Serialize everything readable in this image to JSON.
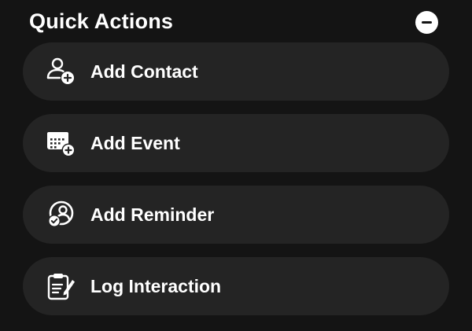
{
  "header": {
    "title": "Quick Actions",
    "collapse_icon": "minus-circle-icon"
  },
  "actions": [
    {
      "label": "Add Contact",
      "icon": "add-contact-icon"
    },
    {
      "label": "Add Event",
      "icon": "add-event-icon"
    },
    {
      "label": "Add Reminder",
      "icon": "add-reminder-icon"
    },
    {
      "label": "Log Interaction",
      "icon": "log-interaction-icon"
    }
  ],
  "colors": {
    "background": "#141414",
    "row_background": "#242424",
    "text": "#ffffff"
  }
}
